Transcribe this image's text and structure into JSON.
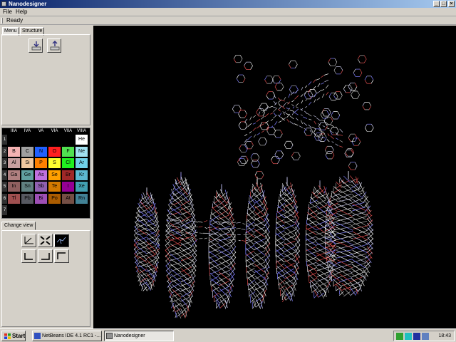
{
  "window": {
    "title": "Nanodesigner"
  },
  "menu": {
    "items": [
      "File",
      "Help"
    ]
  },
  "status": {
    "text": "Ready"
  },
  "tabs": {
    "menu": "Menu",
    "structure": "Structure"
  },
  "periodic_table": {
    "groups": [
      "IIIA",
      "IVA",
      "VA",
      "VIA",
      "VIIA",
      "VIIIA"
    ],
    "periods": [
      "1",
      "2",
      "3",
      "4",
      "5",
      "6",
      "7"
    ],
    "rows": [
      [
        null,
        null,
        null,
        null,
        null,
        "He"
      ],
      [
        "B",
        "C",
        "N",
        "O",
        "F",
        "Ne"
      ],
      [
        "Al",
        "Si",
        "P",
        "S",
        "Cl",
        "Ar"
      ],
      [
        "Ga",
        "Ge",
        "As",
        "Se",
        "Br",
        "Kr"
      ],
      [
        "In",
        "Sn",
        "Sb",
        "Te",
        "I",
        "Xe"
      ],
      [
        "Tl",
        "Pb",
        "Bi",
        "Po",
        "At",
        "Rn"
      ],
      [
        null,
        null,
        null,
        null,
        null,
        null
      ]
    ],
    "colors": [
      [
        null,
        null,
        null,
        null,
        null,
        "#ffffff"
      ],
      [
        "#f4b2b2",
        "#a0a0a0",
        "#2060ff",
        "#ff2020",
        "#50e050",
        "#a0e0f0"
      ],
      [
        "#c8a0a0",
        "#f0c8a0",
        "#ff8000",
        "#ffff30",
        "#20f020",
        "#70d0e8"
      ],
      [
        "#b08080",
        "#60a0a0",
        "#c070e0",
        "#ffa000",
        "#a02828",
        "#5cb8d1"
      ],
      [
        "#906060",
        "#608080",
        "#9060b0",
        "#d47a00",
        "#940094",
        "#42a0b0"
      ],
      [
        "#a05050",
        "#575961",
        "#9e4fb5",
        "#ab5c00",
        "#754f45",
        "#428296"
      ],
      [
        null,
        null,
        null,
        null,
        null,
        null
      ]
    ]
  },
  "change_view": {
    "label": "Change view"
  },
  "taskbar": {
    "start": "Start",
    "tasks": [
      "NetBeans IDE 4.1 RC1 -...",
      "Nanodesigner"
    ],
    "clock": "18:43"
  }
}
